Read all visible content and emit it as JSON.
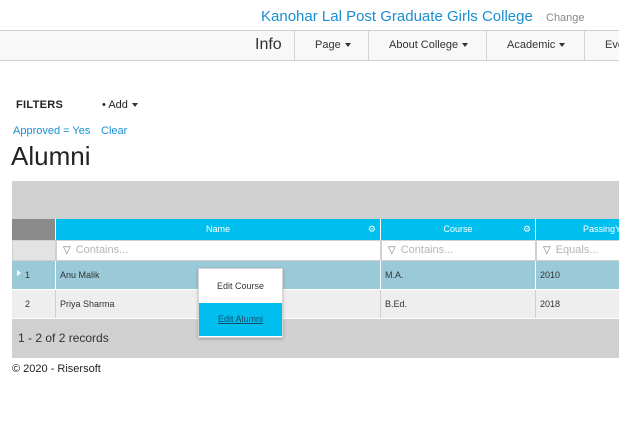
{
  "header": {
    "college_name": "Kanohar Lal Post Graduate Girls College",
    "change_label": "Change"
  },
  "navbar": {
    "brand": "Info",
    "items": [
      {
        "label": "Page"
      },
      {
        "label": "About College"
      },
      {
        "label": "Academic"
      },
      {
        "label": "Eve"
      }
    ]
  },
  "filters": {
    "label": "FILTERS",
    "add_label": "Add",
    "active_filter": "Approved = Yes",
    "clear_label": "Clear"
  },
  "page_title": "Alumni",
  "grid": {
    "columns": [
      {
        "header": "Name",
        "filter_placeholder": "Contains..."
      },
      {
        "header": "Course",
        "filter_placeholder": "Contains..."
      },
      {
        "header": "PassingYe",
        "filter_placeholder": "Equals..."
      }
    ],
    "rows": [
      {
        "num": "1",
        "name": "Anu Malik",
        "course": "M.A.",
        "passing_year": "2010"
      },
      {
        "num": "2",
        "name": "Priya Sharma",
        "course": "B.Ed.",
        "passing_year": "2018"
      }
    ],
    "record_count": "1 - 2 of 2 records"
  },
  "context_menu": {
    "items": [
      {
        "label": "Edit Course"
      },
      {
        "label": "Edit Alumni"
      }
    ]
  },
  "footer": {
    "copyright": "© 2020 - Risersoft"
  },
  "colors": {
    "accent": "#00bfef",
    "link": "#1a8ed0",
    "selected_row": "#9ac9d8"
  },
  "icons": {
    "column_menu": "gear-icon",
    "filter": "funnel-icon",
    "dropdown": "caret-down-icon",
    "current_row": "row-indicator-icon"
  }
}
